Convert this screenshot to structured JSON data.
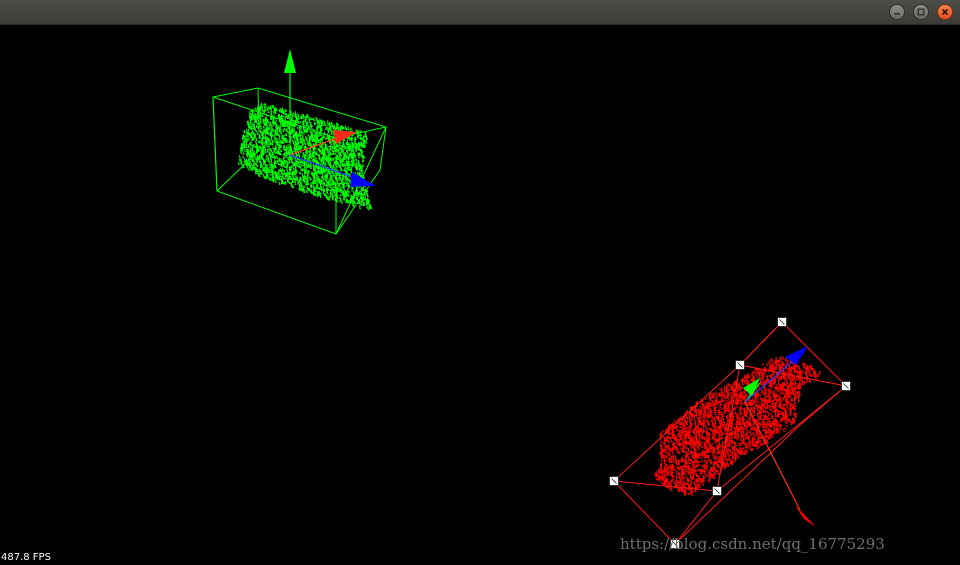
{
  "window": {
    "buttons": [
      {
        "name": "minimize",
        "icon": "minimize-icon"
      },
      {
        "name": "maximize",
        "icon": "maximize-icon"
      },
      {
        "name": "close",
        "icon": "close-icon"
      }
    ]
  },
  "overlay": {
    "fps": "487.8 FPS",
    "watermark": "https://blog.csdn.net/qq_16775293"
  },
  "scene": {
    "objects": [
      {
        "name": "green-point-cloud",
        "color": "#00ff00",
        "bbox_color": "#00ff00",
        "selected": false
      },
      {
        "name": "red-point-cloud",
        "color": "#ff0000",
        "bbox_color": "#ff0000",
        "selected": true
      }
    ],
    "axis_colors": {
      "x": "#ff0000",
      "y": "#00ff00",
      "z": "#0000ff"
    },
    "handle_color": "#ffffff"
  }
}
